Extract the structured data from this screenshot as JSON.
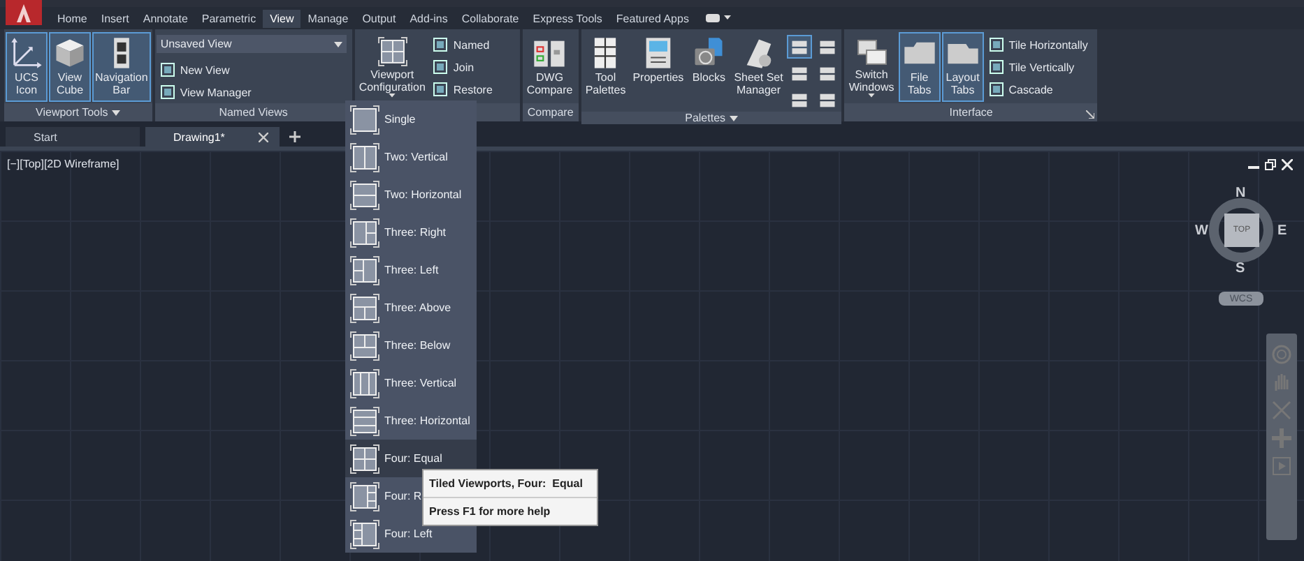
{
  "ribbon_tabs": [
    {
      "label": "Home",
      "selected": false
    },
    {
      "label": "Insert",
      "selected": false
    },
    {
      "label": "Annotate",
      "selected": false
    },
    {
      "label": "Parametric",
      "selected": false
    },
    {
      "label": "View",
      "selected": true
    },
    {
      "label": "Manage",
      "selected": false
    },
    {
      "label": "Output",
      "selected": false
    },
    {
      "label": "Add-ins",
      "selected": false
    },
    {
      "label": "Collaborate",
      "selected": false
    },
    {
      "label": "Express Tools",
      "selected": false
    },
    {
      "label": "Featured Apps",
      "selected": false
    }
  ],
  "panels": [
    {
      "title": "Viewport Tools",
      "title_menu": true,
      "buttons": [
        {
          "label": "UCS\nIcon",
          "on": true
        },
        {
          "label": "View\nCube",
          "on": true
        },
        {
          "label": "Navigation\nBar",
          "on": true
        }
      ]
    },
    {
      "title": "Named Views",
      "dropdown": "Unsaved View",
      "list": [
        "New View",
        "View Manager"
      ]
    },
    {
      "buttons": [
        {
          "label": "Viewport\nConfiguration",
          "on": false,
          "menu": true
        }
      ],
      "list": [
        "Named",
        "Join",
        "Restore"
      ]
    },
    {
      "title": "Compare",
      "buttons": [
        {
          "label": "DWG\nCompare",
          "on": false
        }
      ]
    },
    {
      "title": "Palettes",
      "title_menu": true,
      "buttons": [
        {
          "label": "Tool\nPalettes",
          "on": false
        },
        {
          "label": "Properties",
          "on": false
        },
        {
          "label": "Blocks",
          "on": false
        },
        {
          "label": "Sheet Set\nManager",
          "on": false
        }
      ],
      "small_icons": [
        {
          "on": true
        },
        {
          "on": false
        },
        {
          "on": false
        },
        {
          "on": false
        },
        {
          "on": false
        },
        {
          "on": false
        }
      ]
    },
    {
      "title": "Interface",
      "launcher": true,
      "buttons": [
        {
          "label": "Switch\nWindows",
          "on": false,
          "menu": true
        },
        {
          "label": "File\nTabs",
          "on": true
        },
        {
          "label": "Layout\nTabs",
          "on": true
        }
      ],
      "list": [
        "Tile Horizontally",
        "Tile Vertically",
        "Cascade"
      ]
    }
  ],
  "file_tabs": [
    {
      "label": "Start",
      "selected": false,
      "closable": false
    },
    {
      "label": "Drawing1*",
      "selected": true,
      "closable": true
    }
  ],
  "viewport_label": "[−][Top][2D Wireframe]",
  "viewcube": {
    "face": "TOP",
    "north": "N",
    "south": "S",
    "east": "E",
    "west": "W",
    "ucs": "WCS"
  },
  "viewport_menu": [
    {
      "label": "Single",
      "kind": "single",
      "selected": false
    },
    {
      "label": "Two: Vertical",
      "kind": "two-vertical",
      "selected": false
    },
    {
      "label": "Two: Horizontal",
      "kind": "two-horizontal",
      "selected": false
    },
    {
      "label": "Three: Right",
      "kind": "three-right",
      "selected": false
    },
    {
      "label": "Three: Left",
      "kind": "three-left",
      "selected": false
    },
    {
      "label": "Three: Above",
      "kind": "three-above",
      "selected": false
    },
    {
      "label": "Three: Below",
      "kind": "three-below",
      "selected": false
    },
    {
      "label": "Three: Vertical",
      "kind": "three-vertical",
      "selected": false
    },
    {
      "label": "Three: Horizontal",
      "kind": "three-horizontal",
      "selected": false
    },
    {
      "label": "Four: Equal",
      "kind": "four-equal",
      "selected": true
    },
    {
      "label": "Four: R",
      "kind": "four-right",
      "selected": false
    },
    {
      "label": "Four: Left",
      "kind": "four-left",
      "selected": false
    }
  ],
  "tooltip": {
    "title": "Tiled Viewports, Four:  Equal",
    "help": "Press F1 for more help"
  }
}
